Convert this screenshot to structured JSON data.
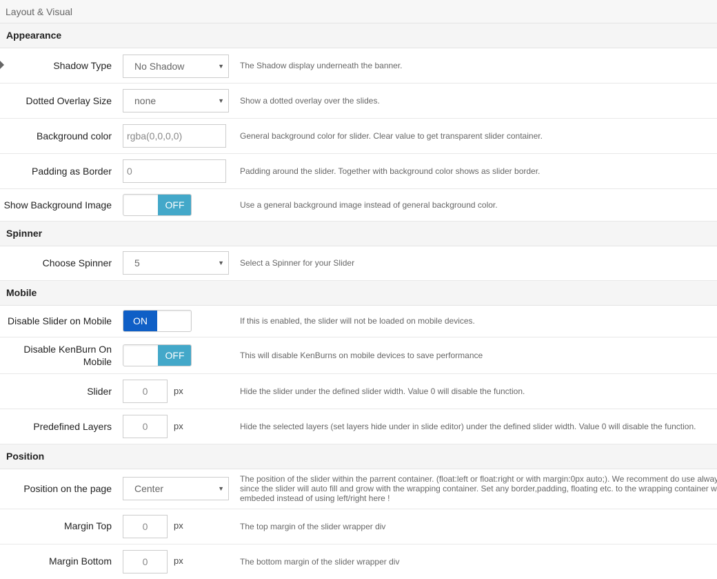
{
  "panel_title": "Layout & Visual",
  "sections": {
    "appearance": "Appearance",
    "spinner": "Spinner",
    "mobile": "Mobile",
    "position": "Position"
  },
  "shadow_type": {
    "label": "Shadow Type",
    "value": "No Shadow",
    "desc": "The Shadow display underneath the banner."
  },
  "dotted_overlay": {
    "label": "Dotted Overlay Size",
    "value": "none",
    "desc": "Show a dotted overlay over the slides."
  },
  "background_color": {
    "label": "Background color",
    "value": "rgba(0,0,0,0)",
    "desc": "General background color for slider. Clear value to get transparent slider container."
  },
  "padding_border": {
    "label": "Padding as Border",
    "value": "0",
    "desc": "Padding around the slider. Together with background color shows as slider border."
  },
  "show_bg_image": {
    "label": "Show Background Image",
    "state": "OFF",
    "desc": "Use a general background image instead of general background color."
  },
  "choose_spinner": {
    "label": "Choose Spinner",
    "value": "5",
    "desc": "Select a Spinner for your Slider"
  },
  "disable_mobile": {
    "label": "Disable Slider on Mobile",
    "state": "ON",
    "desc": "If this is enabled, the slider will not be loaded on mobile devices."
  },
  "disable_kenburn": {
    "label_line1": "Disable KenBurn On",
    "label_line2": "Mobile",
    "state": "OFF",
    "desc": "This will disable KenBurns on mobile devices to save performance"
  },
  "slider_width": {
    "label": "Slider",
    "value": "0",
    "unit": "px",
    "desc": "Hide the slider under the defined slider width. Value 0 will disable the function."
  },
  "predefined_layers": {
    "label": "Predefined Layers",
    "value": "0",
    "unit": "px",
    "desc": "Hide the selected layers (set layers hide under in slide editor) under the defined slider width. Value 0 will disable the function."
  },
  "position_page": {
    "label": "Position on the page",
    "value": "Center",
    "desc_line1": "The position of the slider within the parrent container. (float:left or float:right or with margin:0px auto;). We recomment do use alway",
    "desc_line2": "since the slider will auto fill and grow with the wrapping container. Set any border,padding, floating etc. to the wrapping container w",
    "desc_line3": "embeded instead of using left/right here !"
  },
  "margin_top": {
    "label": "Margin Top",
    "value": "0",
    "unit": "px",
    "desc": "The top margin of the slider wrapper div"
  },
  "margin_bottom": {
    "label": "Margin Bottom",
    "value": "0",
    "unit": "px",
    "desc": "The bottom margin of the slider wrapper div"
  },
  "icons": {
    "select_caret": "caret-down-icon",
    "row_marker": "triangle-right-icon"
  },
  "colors": {
    "toggle_on": "#0f5fc6",
    "toggle_off": "#43a8c9"
  }
}
